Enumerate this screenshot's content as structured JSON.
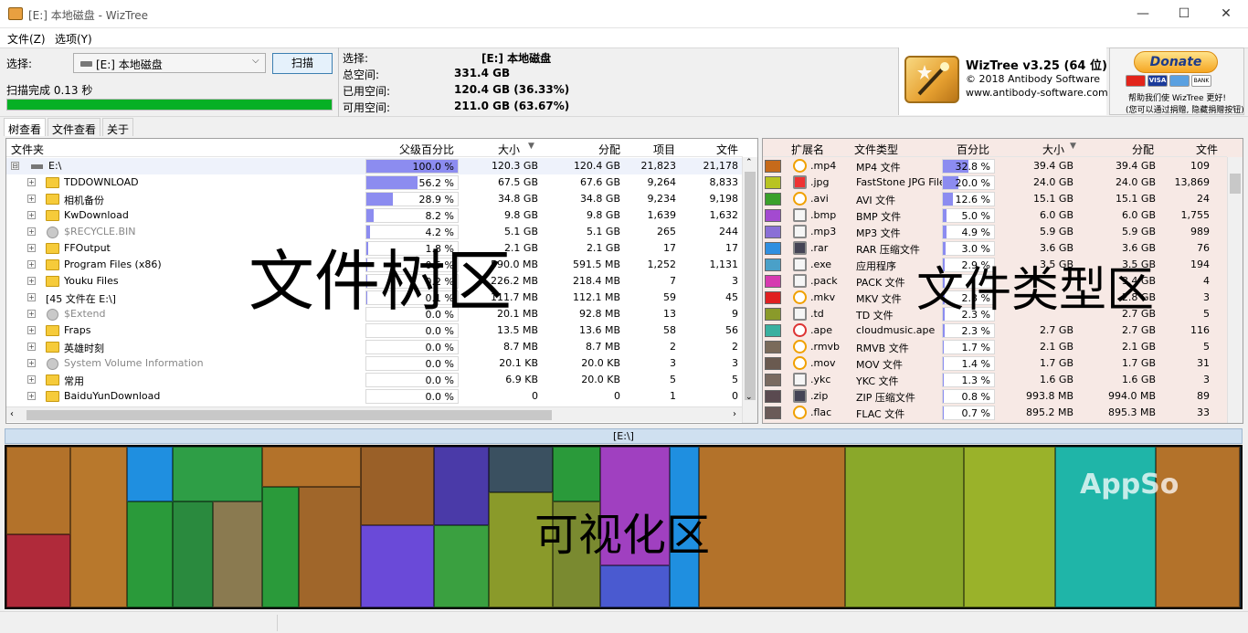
{
  "window": {
    "title": "[E:] 本地磁盘  - WizTree",
    "minimize": "—",
    "maximize": "☐",
    "close": "✕"
  },
  "menu": {
    "file": "文件(Z)",
    "options": "选项(Y)"
  },
  "scan": {
    "select_label": "选择:",
    "drive": "[E:] 本地磁盘",
    "scan_button": "扫描",
    "status": "扫描完成 0.13 秒",
    "progress_pct": 100
  },
  "drive_info": {
    "select_label": "选择:",
    "select_value": "[E:]  本地磁盘",
    "total_label": "总空间:",
    "total_value": "331.4 GB",
    "used_label": "已用空间:",
    "used_value": "120.4 GB  (36.33%)",
    "free_label": "可用空间:",
    "free_value": "211.0 GB  (63.67%)"
  },
  "about": {
    "name": "WizTree v3.25 (64 位)",
    "copyright": "© 2018 Antibody Software",
    "website": "www.antibody-software.com"
  },
  "donate": {
    "button": "Donate",
    "cards": [
      "",
      "VISA",
      "",
      "BANK"
    ],
    "line1": "帮助我们使 WizTree 更好!",
    "line2": "(您可以通过捐赠, 隐藏捐赠按钮)"
  },
  "tabs": [
    {
      "label": "树查看"
    },
    {
      "label": "文件查看"
    },
    {
      "label": "关于"
    }
  ],
  "tree": {
    "columns": [
      "文件夹",
      "父级百分比",
      "大小",
      "分配",
      "项目",
      "文件"
    ],
    "rows": [
      {
        "name": "E:\\",
        "pct": 100.0,
        "pct_text": "100.0 %",
        "size": "120.3 GB",
        "alloc": "120.4 GB",
        "items": "21,823",
        "files": "21,178",
        "icon": "drive-icon",
        "expander": "⊟"
      },
      {
        "name": "TDDOWNLOAD",
        "pct": 56.2,
        "pct_text": "56.2 %",
        "size": "67.5 GB",
        "alloc": "67.6 GB",
        "items": "9,264",
        "files": "8,833",
        "icon": "folder-icon",
        "expander": "+"
      },
      {
        "name": "相机备份",
        "pct": 28.9,
        "pct_text": "28.9 %",
        "size": "34.8 GB",
        "alloc": "34.8 GB",
        "items": "9,234",
        "files": "9,198",
        "icon": "folder-icon",
        "expander": "+"
      },
      {
        "name": "KwDownload",
        "pct": 8.2,
        "pct_text": "8.2 %",
        "size": "9.8 GB",
        "alloc": "9.8 GB",
        "items": "1,639",
        "files": "1,632",
        "icon": "folder-icon",
        "expander": "+"
      },
      {
        "name": "$RECYCLE.BIN",
        "pct": 4.2,
        "pct_text": "4.2 %",
        "size": "5.1 GB",
        "alloc": "5.1 GB",
        "items": "265",
        "files": "244",
        "icon": "system-folder-icon",
        "expander": "+"
      },
      {
        "name": "FFOutput",
        "pct": 1.8,
        "pct_text": "1.8 %",
        "size": "2.1 GB",
        "alloc": "2.1 GB",
        "items": "17",
        "files": "17",
        "icon": "folder-icon",
        "expander": "+"
      },
      {
        "name": "Program Files (x86)",
        "pct": 0.5,
        "pct_text": "0.5 %",
        "size": "590.0 MB",
        "alloc": "591.5 MB",
        "items": "1,252",
        "files": "1,131",
        "icon": "folder-icon",
        "expander": "+"
      },
      {
        "name": "Youku Files",
        "pct": 0.2,
        "pct_text": "0.2 %",
        "size": "226.2 MB",
        "alloc": "218.4 MB",
        "items": "7",
        "files": "3",
        "icon": "folder-icon",
        "expander": "+"
      },
      {
        "name": "[45 文件在 E:\\]",
        "pct": 0.1,
        "pct_text": "0.1 %",
        "size": "111.7 MB",
        "alloc": "112.1 MB",
        "items": "59",
        "files": "45",
        "icon": "",
        "expander": "+"
      },
      {
        "name": "$Extend",
        "pct": 0.0,
        "pct_text": "0.0 %",
        "size": "20.1 MB",
        "alloc": "92.8 MB",
        "items": "13",
        "files": "9",
        "icon": "system-folder-icon",
        "expander": "+"
      },
      {
        "name": "Fraps",
        "pct": 0.0,
        "pct_text": "0.0 %",
        "size": "13.5 MB",
        "alloc": "13.6 MB",
        "items": "58",
        "files": "56",
        "icon": "folder-icon",
        "expander": "+"
      },
      {
        "name": "英雄时刻",
        "pct": 0.0,
        "pct_text": "0.0 %",
        "size": "8.7 MB",
        "alloc": "8.7 MB",
        "items": "2",
        "files": "2",
        "icon": "folder-icon",
        "expander": "+"
      },
      {
        "name": "System Volume Information",
        "pct": 0.0,
        "pct_text": "0.0 %",
        "size": "20.1 KB",
        "alloc": "20.0 KB",
        "items": "3",
        "files": "3",
        "icon": "system-folder-icon",
        "expander": "+"
      },
      {
        "name": "常用",
        "pct": 0.0,
        "pct_text": "0.0 %",
        "size": "6.9 KB",
        "alloc": "20.0 KB",
        "items": "5",
        "files": "5",
        "icon": "folder-icon",
        "expander": "+"
      },
      {
        "name": "BaiduYunDownload",
        "pct": 0.0,
        "pct_text": "0.0 %",
        "size": "0",
        "alloc": "0",
        "items": "1",
        "files": "0",
        "icon": "folder-icon",
        "expander": "+"
      }
    ]
  },
  "types": {
    "columns": [
      "扩展名",
      "文件类型",
      "百分比",
      "大小",
      "分配",
      "文件"
    ],
    "rows": [
      {
        "swatch": "#c66a1a",
        "ext": ".mp4",
        "type": "MP4 文件",
        "pct": 32.8,
        "pct_text": "32.8 %",
        "size": "39.4 GB",
        "alloc": "39.4 GB",
        "files": "109",
        "icon": "media-player-icon"
      },
      {
        "swatch": "#b8c422",
        "ext": ".jpg",
        "type": "FastStone JPG File",
        "pct": 20.0,
        "pct_text": "20.0 %",
        "size": "24.0 GB",
        "alloc": "24.0 GB",
        "files": "13,869",
        "icon": "jpg-file-icon"
      },
      {
        "swatch": "#3aa02a",
        "ext": ".avi",
        "type": "AVI 文件",
        "pct": 12.6,
        "pct_text": "12.6 %",
        "size": "15.1 GB",
        "alloc": "15.1 GB",
        "files": "24",
        "icon": "media-player-icon"
      },
      {
        "swatch": "#a34ad0",
        "ext": ".bmp",
        "type": "BMP 文件",
        "pct": 5.0,
        "pct_text": "5.0 %",
        "size": "6.0 GB",
        "alloc": "6.0 GB",
        "files": "1,755",
        "icon": "image-file-icon"
      },
      {
        "swatch": "#8a6fd6",
        "ext": ".mp3",
        "type": "MP3 文件",
        "pct": 4.9,
        "pct_text": "4.9 %",
        "size": "5.9 GB",
        "alloc": "5.9 GB",
        "files": "989",
        "icon": "audio-file-icon"
      },
      {
        "swatch": "#2f8fe0",
        "ext": ".rar",
        "type": "RAR 压缩文件",
        "pct": 3.0,
        "pct_text": "3.0 %",
        "size": "3.6 GB",
        "alloc": "3.6 GB",
        "files": "76",
        "icon": "rar-archive-icon"
      },
      {
        "swatch": "#4aa0c8",
        "ext": ".exe",
        "type": "应用程序",
        "pct": 2.9,
        "pct_text": "2.9 %",
        "size": "3.5 GB",
        "alloc": "3.5 GB",
        "files": "194",
        "icon": "application-icon"
      },
      {
        "swatch": "#d63ab0",
        "ext": ".pack",
        "type": "PACK 文件",
        "pct": 2.8,
        "pct_text": "",
        "size": "",
        "alloc": "3.4 GB",
        "files": "4",
        "icon": "blank-file-icon"
      },
      {
        "swatch": "#e02020",
        "ext": ".mkv",
        "type": "MKV 文件",
        "pct": 2.3,
        "pct_text": "2.3 %",
        "size": "",
        "alloc": "2.8 GB",
        "files": "3",
        "icon": "media-player-icon"
      },
      {
        "swatch": "#8a9a2a",
        "ext": ".td",
        "type": "TD 文件",
        "pct": 2.3,
        "pct_text": "2.3 %",
        "size": "",
        "alloc": "2.7 GB",
        "files": "5",
        "icon": "td-file-icon"
      },
      {
        "swatch": "#3ab0a0",
        "ext": ".ape",
        "type": "cloudmusic.ape",
        "pct": 2.3,
        "pct_text": "2.3 %",
        "size": "2.7 GB",
        "alloc": "2.7 GB",
        "files": "116",
        "icon": "cloudmusic-icon"
      },
      {
        "swatch": "#7a6a5a",
        "ext": ".rmvb",
        "type": "RMVB 文件",
        "pct": 1.7,
        "pct_text": "1.7 %",
        "size": "2.1 GB",
        "alloc": "2.1 GB",
        "files": "5",
        "icon": "media-player-icon"
      },
      {
        "swatch": "#6a5a50",
        "ext": ".mov",
        "type": "MOV 文件",
        "pct": 1.4,
        "pct_text": "1.4 %",
        "size": "1.7 GB",
        "alloc": "1.7 GB",
        "files": "31",
        "icon": "media-player-icon"
      },
      {
        "swatch": "#7a6a60",
        "ext": ".ykc",
        "type": "YKC 文件",
        "pct": 1.3,
        "pct_text": "1.3 %",
        "size": "1.6 GB",
        "alloc": "1.6 GB",
        "files": "3",
        "icon": "blank-file-icon"
      },
      {
        "swatch": "#5a4a50",
        "ext": ".zip",
        "type": "ZIP 压缩文件",
        "pct": 0.8,
        "pct_text": "0.8 %",
        "size": "993.8 MB",
        "alloc": "994.0 MB",
        "files": "89",
        "icon": "zip-archive-icon"
      },
      {
        "swatch": "#6a5a58",
        "ext": ".flac",
        "type": "FLAC 文件",
        "pct": 0.7,
        "pct_text": "0.7 %",
        "size": "895.2 MB",
        "alloc": "895.3 MB",
        "files": "33",
        "icon": "media-player-icon"
      }
    ]
  },
  "annotations": {
    "tree": "文件树区",
    "types": "文件类型区",
    "visual": "可视化区"
  },
  "treemap": {
    "path": "[E:\\]",
    "watermark": "AppSo"
  }
}
